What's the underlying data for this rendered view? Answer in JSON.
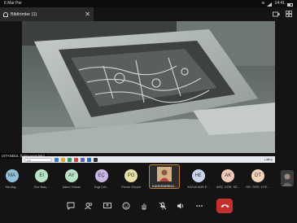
{
  "status_bar": {
    "time": "6 Mar Per",
    "clock": "14:41"
  },
  "notification": {
    "label": "Bildirimler (1)"
  },
  "stage": {
    "presenter_label": "ISTANBUL (bilgisayardaki)"
  },
  "taskbar": {
    "search_placeholder": "Ara"
  },
  "participants": [
    {
      "initials": "MA",
      "name": "Ma Akg...",
      "color": "#8fc0d9"
    },
    {
      "initials": "EI",
      "name": "Ece Batç...",
      "color": "#b9e3c6"
    },
    {
      "initials": "AY",
      "name": "Adem Yılmaz",
      "color": "#b9e3c6"
    },
    {
      "initials": "EÇ",
      "name": "Ezgi Çet...",
      "color": "#c9b8e6"
    },
    {
      "initials": "PG",
      "name": "Pervin Gürpür",
      "color": "#e8e0a6"
    },
    {
      "initials": "",
      "name": "KANDEMİRBUL...",
      "color": "#c6a07c",
      "active": true
    },
    {
      "initials": "HE",
      "name": "HAVVA NUR E...",
      "color": "#c9d4ee"
    },
    {
      "initials": "AK",
      "name": "ARŞ. GÖR. SE...",
      "color": "#f1c9b8"
    },
    {
      "initials": "DT",
      "name": "DR. ÖĞR. ÜYE...",
      "color": "#f1d4b8"
    }
  ],
  "controls": {
    "chat": "chat-icon",
    "people": "people-icon",
    "share": "share-screen-icon",
    "react": "reaction-icon",
    "hand": "raise-hand-icon",
    "mic": "mic-off-icon",
    "speaker": "speaker-icon",
    "more": "more-icon",
    "end": "end-call-icon"
  }
}
